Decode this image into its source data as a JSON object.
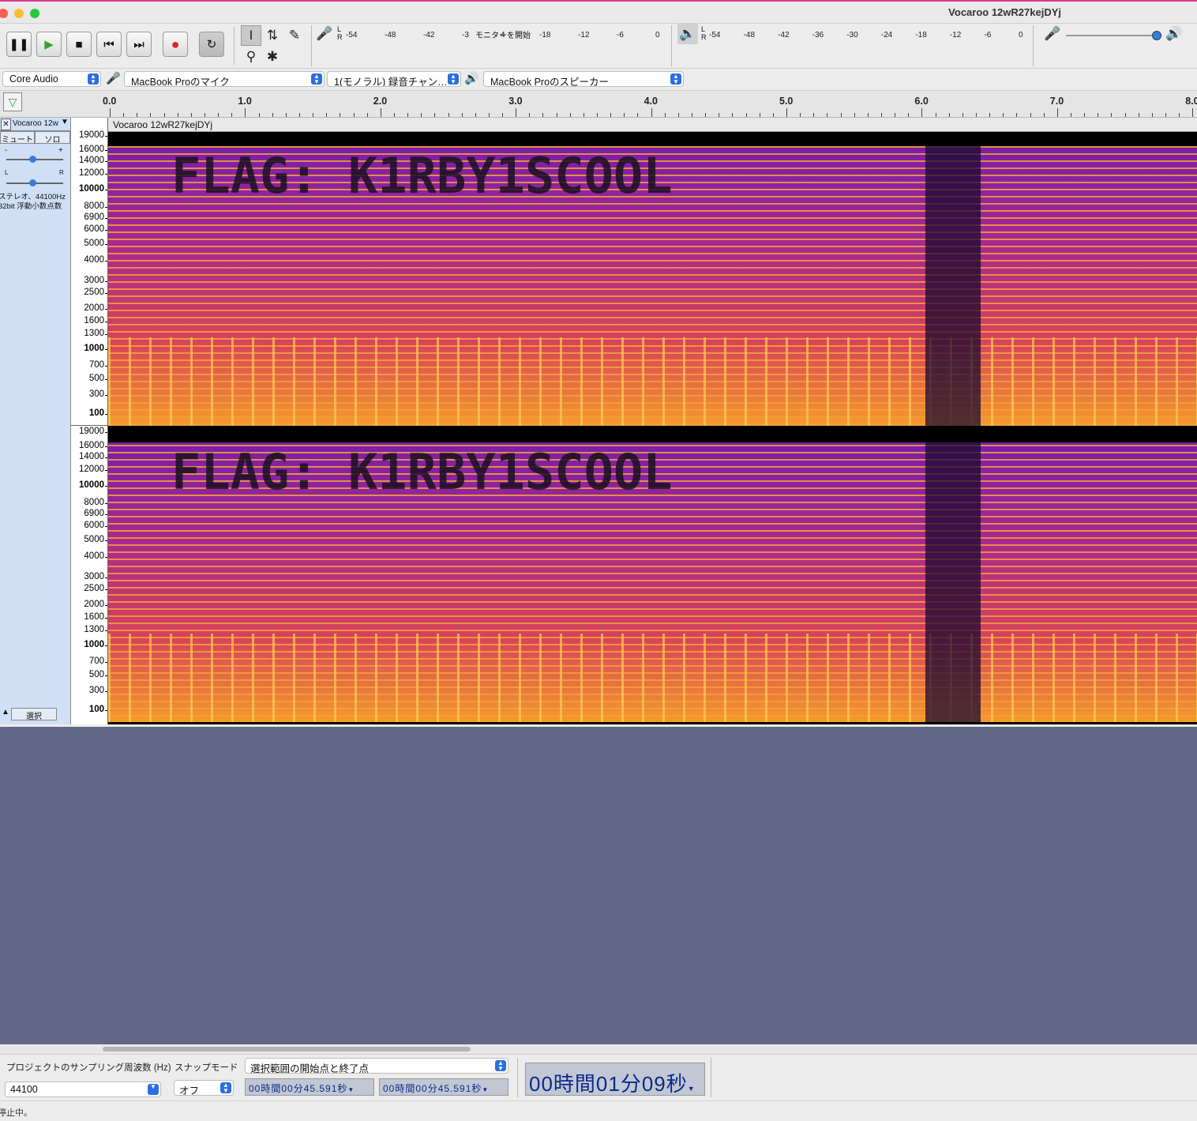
{
  "window": {
    "title": "Vocaroo 12wR27kejDYj"
  },
  "colors": {
    "title_accent": "#d63a8e",
    "track_panel": "#cfe0f6",
    "empty_area": "#636786",
    "timecode_text": "#0b2a8a"
  },
  "transport": {
    "pause_icon": "pause-icon",
    "play_icon": "play-icon",
    "stop_icon": "stop-icon",
    "skip_start_icon": "skip-start-icon",
    "skip_end_icon": "skip-end-icon",
    "record_icon": "record-icon",
    "loop_icon": "loop-icon"
  },
  "tools": [
    "selection-tool-icon",
    "envelope-tool-icon",
    "draw-tool-icon",
    "zoom-tool-icon",
    "multi-tool-icon"
  ],
  "record_meter": {
    "channels": [
      "L",
      "R"
    ],
    "scale": [
      "-54",
      "-48",
      "-42",
      "-3",
      "4",
      "-18",
      "-12",
      "-6",
      "0"
    ],
    "overlay": "モニターを開始"
  },
  "play_meter": {
    "channels": [
      "L",
      "R"
    ],
    "scale": [
      "-54",
      "-48",
      "-42",
      "-36",
      "-30",
      "-24",
      "-18",
      "-12",
      "-6",
      "0"
    ]
  },
  "mixer": {
    "volume_level": 0.95
  },
  "device_bar": {
    "host": "Core Audio",
    "recording_device": "MacBook Proのマイク",
    "channels": "1(モノラル) 録音チャン…",
    "playback_device": "MacBook Proのスピーカー"
  },
  "timeline": {
    "labels": [
      "0.0",
      "1.0",
      "2.0",
      "3.0",
      "4.0",
      "5.0",
      "6.0",
      "7.0",
      "8.0"
    ]
  },
  "track": {
    "name": "Vocaroo 12w",
    "mute_label": "ミュート",
    "solo_label": "ソロ",
    "gain_minus": "-",
    "gain_plus": "+",
    "pan_left": "L",
    "pan_right": "R",
    "info_line1": "ステレオ、44100Hz",
    "info_line2": "32bit 浮動小数点数",
    "select_label": "選択",
    "clip_name": "Vocaroo 12wR27kejDYj"
  },
  "freq_axis": {
    "labels": [
      "19000",
      "16000",
      "14000",
      "12000",
      "10000",
      "8000",
      "6900",
      "6000",
      "5000",
      "4000",
      "3000",
      "2500",
      "2000",
      "1600",
      "1300",
      "1000",
      "700",
      "500",
      "300",
      "100"
    ],
    "bold": [
      "10000",
      "1000",
      "100"
    ]
  },
  "spectrogram": {
    "hidden_text": "FLAG: K1RBY1SCOOL"
  },
  "selection_toolbar": {
    "rate_label": "プロジェクトのサンプリング周波数 (Hz)",
    "rate_value": "44100",
    "snap_label": "スナップモード",
    "snap_value": "オフ",
    "range_mode": "選択範囲の開始点と終了点",
    "start_time": "00時間00分45.591秒",
    "end_time": "00時間00分45.591秒",
    "audio_position": "00時間01分09秒"
  },
  "status": {
    "text": "停止中。"
  }
}
